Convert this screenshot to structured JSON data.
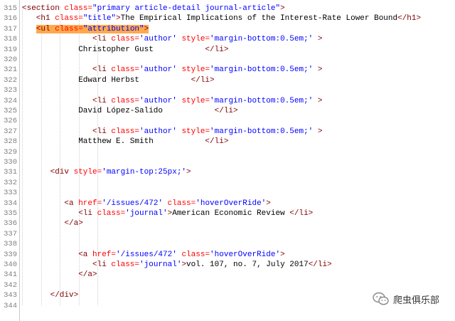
{
  "editor": {
    "lines": [
      {
        "num": "315",
        "indent": 0,
        "html": [
          {
            "c": "tag",
            "t": "<section "
          },
          {
            "c": "attr",
            "t": "class="
          },
          {
            "c": "val",
            "t": "\"primary article-detail journal-article\""
          },
          {
            "c": "tag",
            "t": ">"
          }
        ]
      },
      {
        "num": "316",
        "indent": 3,
        "html": [
          {
            "c": "tag",
            "t": "<h1 "
          },
          {
            "c": "attr",
            "t": "class="
          },
          {
            "c": "val",
            "t": "\"title\""
          },
          {
            "c": "tag",
            "t": ">"
          },
          {
            "c": "txt",
            "t": "The Empirical Implications of the Interest-Rate Lower Bound"
          },
          {
            "c": "tag",
            "t": "</h1>"
          }
        ]
      },
      {
        "num": "317",
        "indent": 3,
        "highlight": true,
        "html": [
          {
            "c": "tag",
            "t": "<ul "
          },
          {
            "c": "attr",
            "t": "class="
          },
          {
            "c": "val",
            "t": "\"attribution\""
          },
          {
            "c": "tag",
            "t": ">"
          }
        ]
      },
      {
        "num": "318",
        "indent": 15,
        "html": [
          {
            "c": "tag",
            "t": "<li "
          },
          {
            "c": "attr",
            "t": "class="
          },
          {
            "c": "val",
            "t": "'author' "
          },
          {
            "c": "attr",
            "t": "style="
          },
          {
            "c": "val",
            "t": "'margin-bottom:0.5em;'"
          },
          {
            "c": "tag",
            "t": " >"
          }
        ]
      },
      {
        "num": "319",
        "indent": 12,
        "html": [
          {
            "c": "txt",
            "t": "Christopher Gust           "
          },
          {
            "c": "tag",
            "t": "</li>"
          }
        ]
      },
      {
        "num": "320",
        "indent": 0,
        "html": []
      },
      {
        "num": "321",
        "indent": 15,
        "html": [
          {
            "c": "tag",
            "t": "<li "
          },
          {
            "c": "attr",
            "t": "class="
          },
          {
            "c": "val",
            "t": "'author' "
          },
          {
            "c": "attr",
            "t": "style="
          },
          {
            "c": "val",
            "t": "'margin-bottom:0.5em;'"
          },
          {
            "c": "tag",
            "t": " >"
          }
        ]
      },
      {
        "num": "322",
        "indent": 12,
        "html": [
          {
            "c": "txt",
            "t": "Edward Herbst           "
          },
          {
            "c": "tag",
            "t": "</li>"
          }
        ]
      },
      {
        "num": "323",
        "indent": 0,
        "html": []
      },
      {
        "num": "324",
        "indent": 15,
        "html": [
          {
            "c": "tag",
            "t": "<li "
          },
          {
            "c": "attr",
            "t": "class="
          },
          {
            "c": "val",
            "t": "'author' "
          },
          {
            "c": "attr",
            "t": "style="
          },
          {
            "c": "val",
            "t": "'margin-bottom:0.5em;'"
          },
          {
            "c": "tag",
            "t": " >"
          }
        ]
      },
      {
        "num": "325",
        "indent": 12,
        "html": [
          {
            "c": "txt",
            "t": "David López-Salido           "
          },
          {
            "c": "tag",
            "t": "</li>"
          }
        ]
      },
      {
        "num": "326",
        "indent": 0,
        "html": []
      },
      {
        "num": "327",
        "indent": 15,
        "html": [
          {
            "c": "tag",
            "t": "<li "
          },
          {
            "c": "attr",
            "t": "class="
          },
          {
            "c": "val",
            "t": "'author' "
          },
          {
            "c": "attr",
            "t": "style="
          },
          {
            "c": "val",
            "t": "'margin-bottom:0.5em;'"
          },
          {
            "c": "tag",
            "t": " >"
          }
        ]
      },
      {
        "num": "328",
        "indent": 12,
        "html": [
          {
            "c": "txt",
            "t": "Matthew E. Smith           "
          },
          {
            "c": "tag",
            "t": "</li>"
          }
        ]
      },
      {
        "num": "329",
        "indent": 0,
        "html": []
      },
      {
        "num": "330",
        "indent": 0,
        "html": []
      },
      {
        "num": "331",
        "indent": 6,
        "html": [
          {
            "c": "tag",
            "t": "<div "
          },
          {
            "c": "attr",
            "t": "style="
          },
          {
            "c": "val",
            "t": "'margin-top:25px;'"
          },
          {
            "c": "tag",
            "t": ">"
          }
        ]
      },
      {
        "num": "332",
        "indent": 0,
        "html": []
      },
      {
        "num": "333",
        "indent": 0,
        "html": []
      },
      {
        "num": "334",
        "indent": 9,
        "html": [
          {
            "c": "tag",
            "t": "<a "
          },
          {
            "c": "attr",
            "t": "href="
          },
          {
            "c": "val",
            "t": "'/issues/472' "
          },
          {
            "c": "attr",
            "t": "class="
          },
          {
            "c": "val",
            "t": "'hoverOverRide'"
          },
          {
            "c": "tag",
            "t": ">"
          }
        ]
      },
      {
        "num": "335",
        "indent": 12,
        "html": [
          {
            "c": "tag",
            "t": "<li "
          },
          {
            "c": "attr",
            "t": "class="
          },
          {
            "c": "val",
            "t": "'journal'"
          },
          {
            "c": "tag",
            "t": ">"
          },
          {
            "c": "txt",
            "t": "American Economic Review "
          },
          {
            "c": "tag",
            "t": "</li>"
          }
        ]
      },
      {
        "num": "336",
        "indent": 9,
        "html": [
          {
            "c": "tag",
            "t": "</a>"
          }
        ]
      },
      {
        "num": "337",
        "indent": 0,
        "html": []
      },
      {
        "num": "338",
        "indent": 0,
        "html": []
      },
      {
        "num": "339",
        "indent": 12,
        "html": [
          {
            "c": "tag",
            "t": "<a "
          },
          {
            "c": "attr",
            "t": "href="
          },
          {
            "c": "val",
            "t": "'/issues/472' "
          },
          {
            "c": "attr",
            "t": "class="
          },
          {
            "c": "val",
            "t": "'hoverOverRide'"
          },
          {
            "c": "tag",
            "t": ">"
          }
        ]
      },
      {
        "num": "340",
        "indent": 15,
        "html": [
          {
            "c": "tag",
            "t": "<li "
          },
          {
            "c": "attr",
            "t": "class="
          },
          {
            "c": "val",
            "t": "'journal'"
          },
          {
            "c": "tag",
            "t": ">"
          },
          {
            "c": "txt",
            "t": "vol. 107, no. 7, July 2017"
          },
          {
            "c": "tag",
            "t": "</li>"
          }
        ]
      },
      {
        "num": "341",
        "indent": 12,
        "html": [
          {
            "c": "tag",
            "t": "</a>"
          }
        ]
      },
      {
        "num": "342",
        "indent": 0,
        "html": []
      },
      {
        "num": "343",
        "indent": 6,
        "html": [
          {
            "c": "tag",
            "t": "</div>"
          }
        ]
      },
      {
        "num": "344",
        "indent": 0,
        "html": []
      }
    ]
  },
  "watermark": {
    "label": "爬虫俱乐部",
    "icon": "wechat-icon"
  },
  "colors": {
    "tag": "#800000",
    "attr": "#ff0000",
    "value": "#0000ff",
    "highlight": "#ffa94d"
  }
}
